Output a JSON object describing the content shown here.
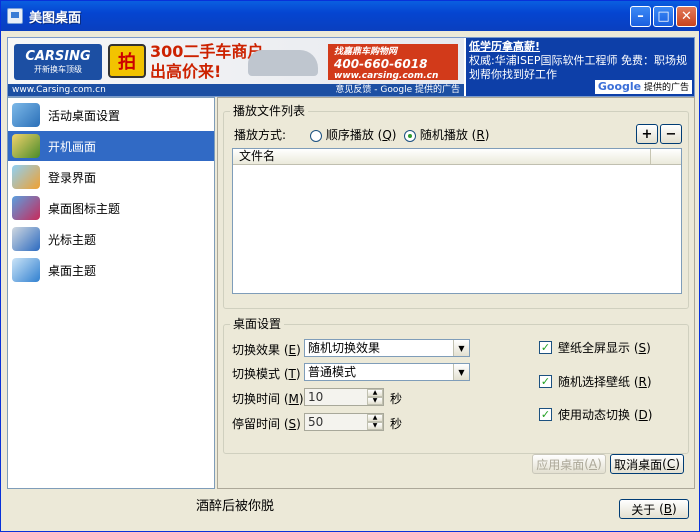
{
  "window": {
    "title": "美图桌面",
    "min": "–",
    "max": "□",
    "close": "✕"
  },
  "ad": {
    "logo": "CARSING",
    "logo_sub": "开新换车顶级",
    "url": "www.Carsing.com.cn",
    "feedback": "意见反馈 - Google 提供的广告",
    "badge": "拍",
    "slogan_line1": "300二手车商户",
    "slogan_line2": "出高价来!",
    "phone_caption": "找嘉鼎车购物网",
    "phone": "400-660-6018",
    "phone_url": "www.carsing.com.cn",
    "right_headline": "低学历拿高薪!",
    "right_body": "权威:华浦ISEP国际软件工程师 免费：职场规划帮你找到好工作",
    "google_label": "Google",
    "google_suffix": "提供的广告"
  },
  "sidebar": {
    "items": [
      {
        "label": "活动桌面设置",
        "icon": "active-desktop-icon"
      },
      {
        "label": "开机画面",
        "icon": "boot-screen-icon",
        "active": true
      },
      {
        "label": "登录界面",
        "icon": "login-screen-icon"
      },
      {
        "label": "桌面图标主题",
        "icon": "desktop-icon-theme-icon"
      },
      {
        "label": "光标主题",
        "icon": "cursor-theme-icon"
      },
      {
        "label": "桌面主题",
        "icon": "desktop-theme-icon"
      }
    ]
  },
  "playlist": {
    "group_title": "播放文件列表",
    "mode_label": "播放方式:",
    "mode_sequential": "顺序播放",
    "mode_sequential_key": "Q",
    "mode_random": "随机播放",
    "mode_random_key": "R",
    "selected_mode": "random",
    "add_label": "+",
    "remove_label": "−",
    "column_filename": "文件名"
  },
  "desktop_settings": {
    "group_title": "桌面设置",
    "effect_label": "切换效果",
    "effect_key": "E",
    "effect_value": "随机切换效果",
    "mode_label": "切换模式",
    "mode_key": "T",
    "mode_value": "普通模式",
    "switch_time_label": "切换时间",
    "switch_time_key": "M",
    "switch_time_value": "10",
    "stay_time_label": "停留时间",
    "stay_time_key": "S",
    "stay_time_value": "50",
    "seconds_unit": "秒",
    "fullscreen_label": "壁纸全屏显示",
    "fullscreen_key": "S",
    "fullscreen_checked": true,
    "random_wallpaper_label": "随机选择壁纸",
    "random_wallpaper_key": "R",
    "random_wallpaper_checked": true,
    "dynamic_switch_label": "使用动态切换",
    "dynamic_switch_key": "D",
    "dynamic_switch_checked": true
  },
  "buttons": {
    "apply": "应用桌面",
    "apply_key": "A",
    "cancel": "取消桌面",
    "cancel_key": "C",
    "about": "关于",
    "about_key": "B"
  },
  "footer": {
    "text": "酒醉后被你脱"
  }
}
